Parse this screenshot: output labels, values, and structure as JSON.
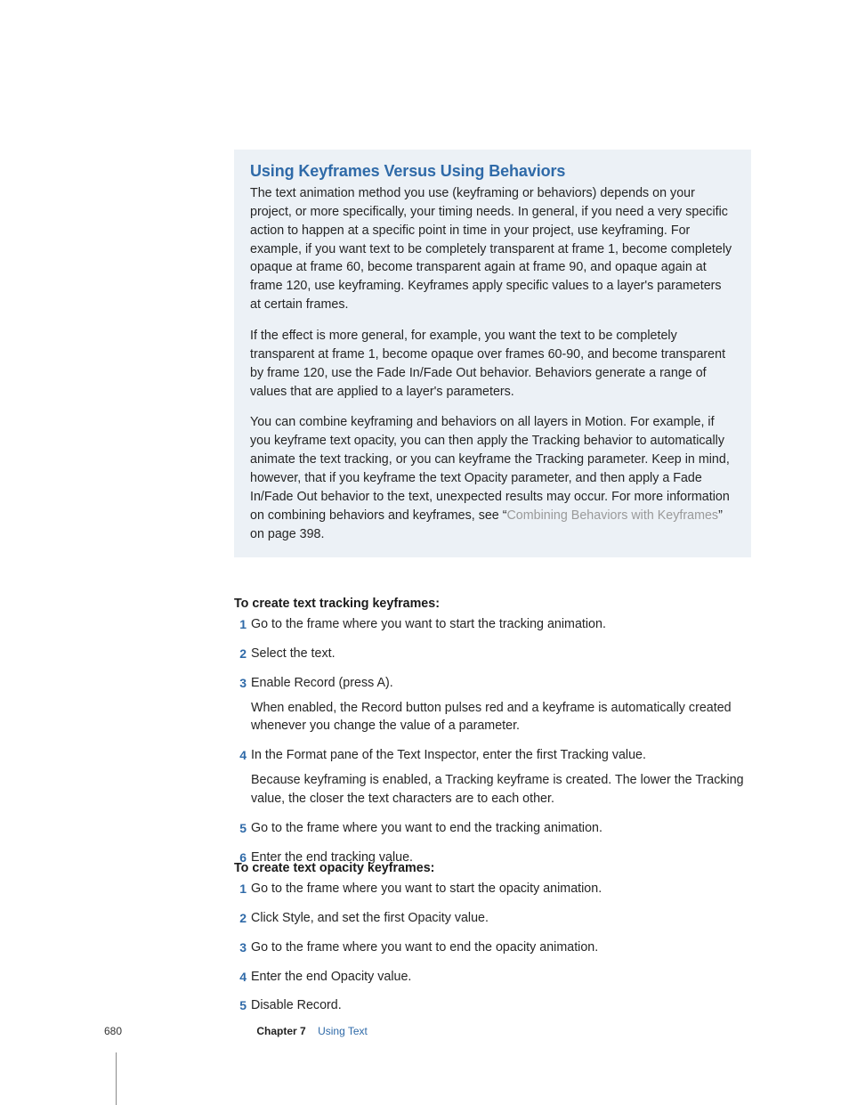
{
  "callout": {
    "title": "Using Keyframes Versus Using Behaviors",
    "p1": "The text animation method you use (keyframing or behaviors) depends on your project, or more specifically, your timing needs. In general, if you need a very specific action to happen at a specific point in time in your project, use keyframing. For example, if you want text to be completely transparent at frame 1, become completely opaque at frame 60, become transparent again at frame 90, and opaque again at frame 120, use keyframing. Keyframes apply specific values to a layer's parameters at certain frames.",
    "p2": "If the effect is more general, for example, you want the text to be completely transparent at frame 1, become opaque over frames 60-90, and become transparent by frame 120, use the Fade In/Fade Out behavior. Behaviors generate a range of values that are applied to a layer's parameters.",
    "p3a": "You can combine keyframing and behaviors on all layers in Motion. For example, if you keyframe text opacity, you can then apply the Tracking behavior to automatically animate the text tracking, or you can keyframe the Tracking parameter. Keep in mind, however, that if you keyframe the text Opacity parameter, and then apply a Fade In/Fade Out behavior to the text, unexpected results may occur. For more information on combining behaviors and keyframes, see “",
    "p3_link": "Combining Behaviors with Keyframes",
    "p3b": "” on page 398."
  },
  "section1": {
    "heading": "To create text tracking keyframes:",
    "steps": [
      {
        "text": "Go to the frame where you want to start the tracking animation."
      },
      {
        "text": "Select the text."
      },
      {
        "text": "Enable Record (press A).",
        "sub": "When enabled, the Record button pulses red and a keyframe is automatically created whenever you change the value of a parameter."
      },
      {
        "text": "In the Format pane of the Text Inspector, enter the first Tracking value.",
        "sub": "Because keyframing is enabled, a Tracking keyframe is created. The lower the Tracking value, the closer the text characters are to each other."
      },
      {
        "text": "Go to the frame where you want to end the tracking animation."
      },
      {
        "text": "Enter the end tracking value."
      }
    ]
  },
  "section2": {
    "heading": "To create text opacity keyframes:",
    "steps": [
      {
        "text": "Go to the frame where you want to start the opacity animation."
      },
      {
        "text": "Click Style, and set the first Opacity value."
      },
      {
        "text": "Go to the frame where you want to end the opacity animation."
      },
      {
        "text": "Enter the end Opacity value."
      },
      {
        "text": "Disable Record."
      }
    ]
  },
  "footer": {
    "page_number": "680",
    "chapter_label": "Chapter 7",
    "chapter_title": "Using Text"
  }
}
